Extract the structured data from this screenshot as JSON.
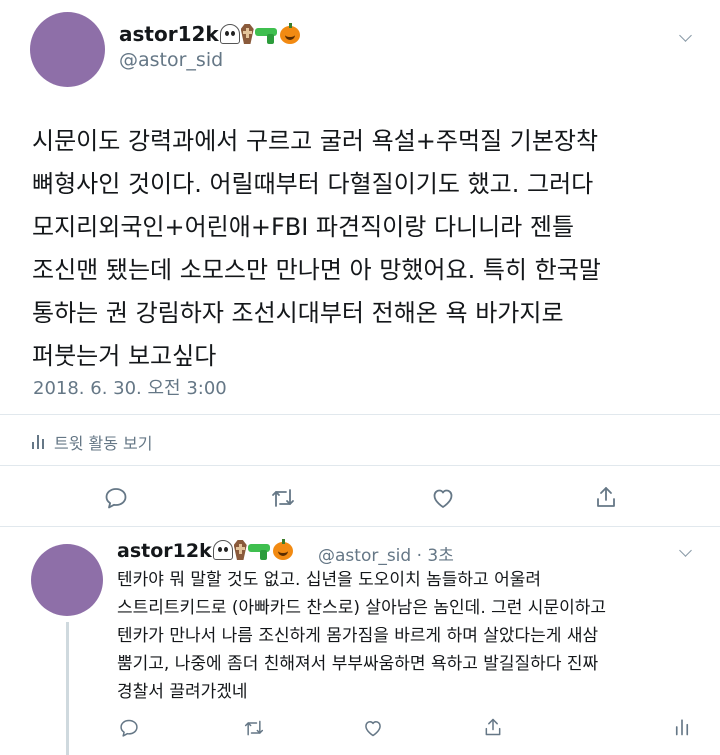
{
  "tweet": {
    "display_name": "astor12k",
    "handle": "@astor_sid",
    "text_lines": [
      "시문이도 강력과에서 구르고 굴러 욕설+주먹질 기본장착",
      "뼈형사인 것이다. 어릴때부터 다혈질이기도 했고. 그러다",
      "모지리외국인+어린애+FBI 파견직이랑 다니니라 젠틀",
      "조신맨 됐는데 소모스만 만나면 아 망했어요. 특히 한국말",
      "통하는 권 강림하자 조선시대부터 전해온 욕 바가지로",
      "퍼붓는거 보고싶다"
    ],
    "timestamp": "2018. 6. 30. 오전 3:00",
    "activity_label": "트윗 활동 보기"
  },
  "reply": {
    "display_name": "astor12k",
    "meta": "@astor_sid · 3초",
    "text_lines": [
      "텐카야 뭐 말할 것도 없고. 십년을 도오이치 놈들하고 어울려",
      "스트리트키드로 (아빠카드 찬스로) 살아남은 놈인데. 그런 시문이하고",
      "텐카가 만나서 나름 조신하게 몸가짐을 바르게 하며 살았다는게 새삼",
      "뿜기고, 나중에 좀더 친해져서 부부싸움하면 욕하고 발길질하다 진짜",
      "경찰서 끌려가겠네"
    ]
  },
  "icons": {
    "name_emojis": [
      "ghost-emoji",
      "coffin-emoji",
      "water-pistol-emoji",
      "jack-o-lantern-emoji"
    ],
    "actions": [
      "reply-icon",
      "retweet-icon",
      "like-icon",
      "share-icon",
      "analytics-icon"
    ]
  },
  "colors": {
    "text": "#14171a",
    "secondary": "#657786",
    "avatar": "#8e6fa8",
    "divider": "#e1e8ed",
    "icon": "#657786"
  }
}
